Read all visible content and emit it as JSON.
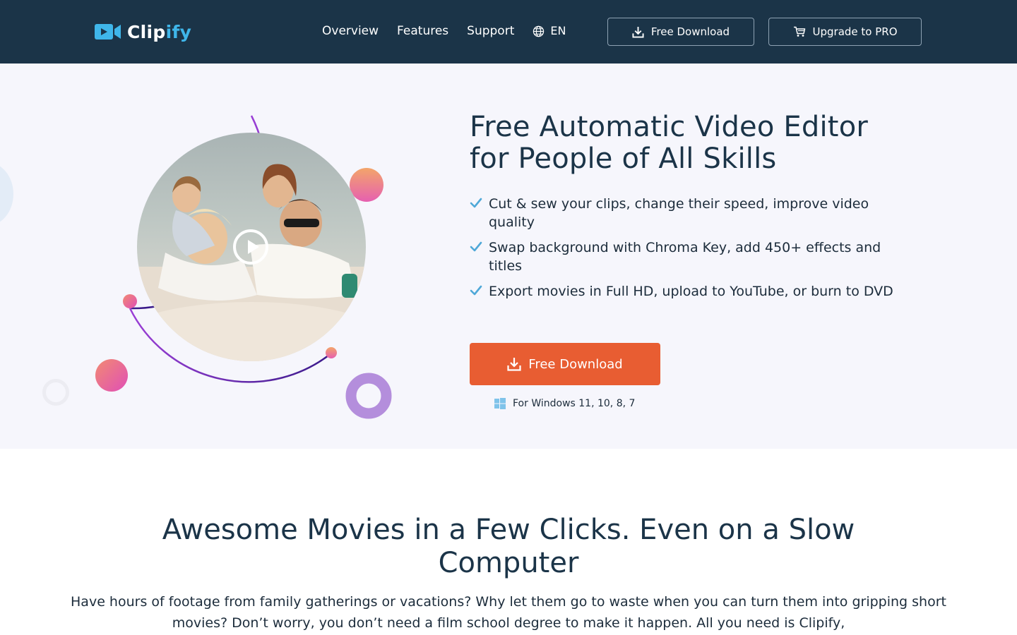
{
  "header": {
    "logo": {
      "part1": "Clip",
      "part2": "ify"
    },
    "nav": [
      {
        "label": "Overview"
      },
      {
        "label": "Features"
      },
      {
        "label": "Support"
      }
    ],
    "language": "EN",
    "free_download_label": "Free Download",
    "upgrade_label": "Upgrade to PRO"
  },
  "hero": {
    "title_line1": "Free Automatic Video Editor",
    "title_line2": "for People of All Skills",
    "features": [
      "Cut & sew your clips, change their speed, improve video quality",
      "Swap background with Chroma Key, add 450+ effects and titles",
      "Export movies in Full HD, upload to YouTube, or burn to DVD"
    ],
    "cta_label": "Free Download",
    "os_note": "For Windows 11, 10, 8, 7"
  },
  "section2": {
    "title": "Awesome Movies in a Few Clicks. Even on a Slow Computer",
    "body": "Have hours of footage from family gatherings or vacations? Why let them go to waste when you can turn them into gripping short movies? Don’t worry, you don’t need a film school degree to make it happen. All you need is Clipify,"
  },
  "colors": {
    "header_bg": "#1b3448",
    "accent_blue": "#3fb6ea",
    "cta_orange": "#e85d32",
    "hero_bg": "#f6f6fc",
    "check_blue": "#4fa8d8"
  },
  "icons": {
    "logo": "video-camera-icon",
    "language": "globe-icon",
    "download": "download-icon",
    "cart": "cart-icon",
    "check": "checkmark-icon",
    "os": "windows-icon",
    "play": "play-icon"
  }
}
